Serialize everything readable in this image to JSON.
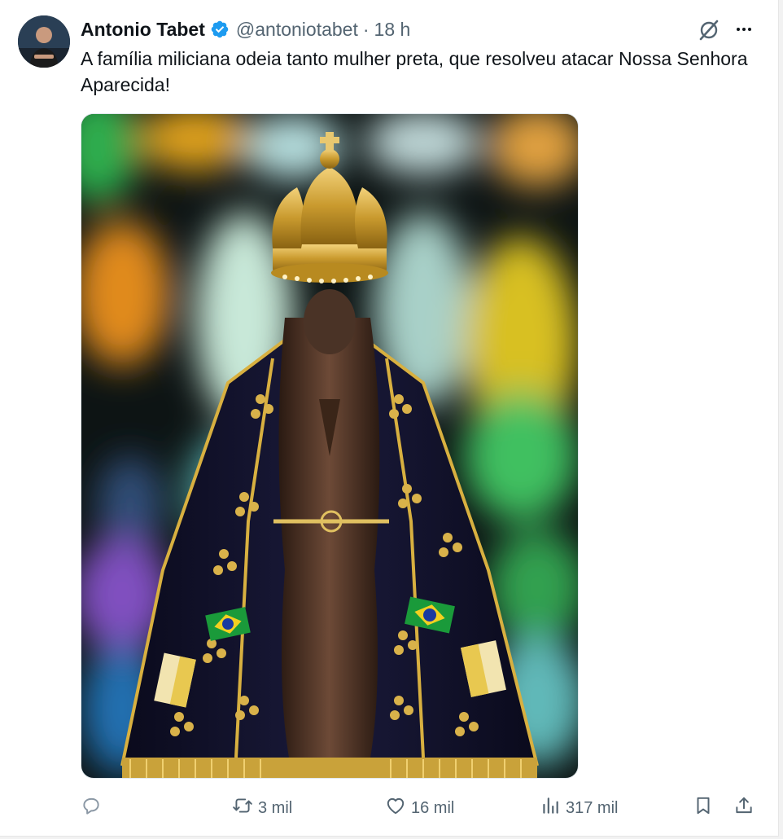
{
  "author": {
    "name": "Antonio Tabet",
    "handle": "@antoniotabet",
    "separator": "·",
    "time": "18 h",
    "verified": true
  },
  "tweet": {
    "text": "A família miliciana odeia tanto mulher preta, que resolveu atacar Nossa Senhora Aparecida!"
  },
  "media": {
    "icon": "statue-image"
  },
  "actions": {
    "replies": "",
    "retweets": "3 mil",
    "likes": "16 mil",
    "views": "317 mil"
  },
  "icons": {
    "reply": "reply-icon",
    "retweet": "retweet-icon",
    "like": "heart-icon",
    "views": "views-icon",
    "bookmark": "bookmark-icon",
    "share": "share-icon",
    "grok": "grok-icon",
    "more": "more-icon",
    "verified": "verified-badge-icon"
  },
  "colors": {
    "verified": "#1d9bf0",
    "secondary_text": "#536471",
    "primary_text": "#0f1419"
  }
}
